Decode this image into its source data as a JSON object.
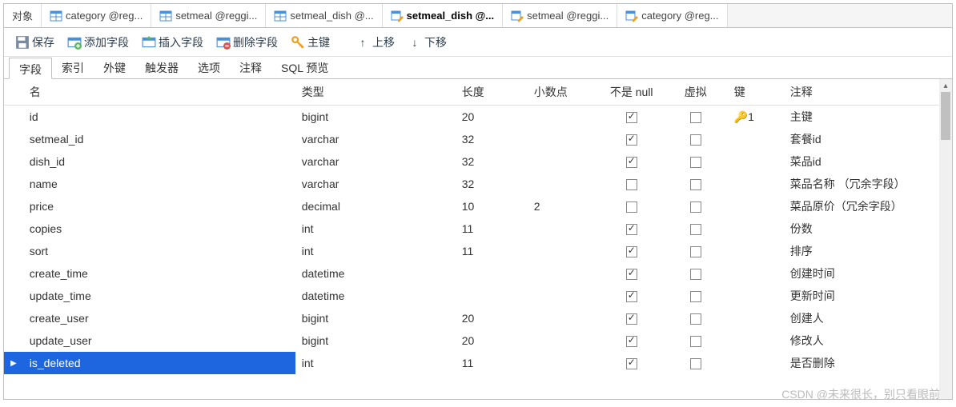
{
  "topTabs": [
    {
      "label": "对象",
      "icon": null,
      "active": false
    },
    {
      "label": "category @reg...",
      "icon": "table",
      "active": false
    },
    {
      "label": "setmeal @reggi...",
      "icon": "table",
      "active": false
    },
    {
      "label": "setmeal_dish @...",
      "icon": "table",
      "active": false
    },
    {
      "label": "setmeal_dish @...",
      "icon": "edit",
      "active": true
    },
    {
      "label": "setmeal @reggi...",
      "icon": "edit",
      "active": false
    },
    {
      "label": "category @reg...",
      "icon": "edit",
      "active": false
    }
  ],
  "toolbar": {
    "save": "保存",
    "addField": "添加字段",
    "insertField": "插入字段",
    "deleteField": "删除字段",
    "primaryKey": "主键",
    "moveUp": "上移",
    "moveDown": "下移"
  },
  "subTabs": [
    "字段",
    "索引",
    "外键",
    "触发器",
    "选项",
    "注释",
    "SQL 预览"
  ],
  "subActive": 0,
  "headers": {
    "name": "名",
    "type": "类型",
    "length": "长度",
    "decimal": "小数点",
    "notnull": "不是 null",
    "virtual": "虚拟",
    "key": "键",
    "comment": "注释"
  },
  "rows": [
    {
      "name": "id",
      "type": "bigint",
      "length": "20",
      "decimal": "",
      "notnull": true,
      "virtual": false,
      "key": "1",
      "comment": "主键"
    },
    {
      "name": "setmeal_id",
      "type": "varchar",
      "length": "32",
      "decimal": "",
      "notnull": true,
      "virtual": false,
      "key": "",
      "comment": "套餐id"
    },
    {
      "name": "dish_id",
      "type": "varchar",
      "length": "32",
      "decimal": "",
      "notnull": true,
      "virtual": false,
      "key": "",
      "comment": "菜品id"
    },
    {
      "name": "name",
      "type": "varchar",
      "length": "32",
      "decimal": "",
      "notnull": false,
      "virtual": false,
      "key": "",
      "comment": "菜品名称 （冗余字段）"
    },
    {
      "name": "price",
      "type": "decimal",
      "length": "10",
      "decimal": "2",
      "notnull": false,
      "virtual": false,
      "key": "",
      "comment": "菜品原价（冗余字段）"
    },
    {
      "name": "copies",
      "type": "int",
      "length": "11",
      "decimal": "",
      "notnull": true,
      "virtual": false,
      "key": "",
      "comment": "份数"
    },
    {
      "name": "sort",
      "type": "int",
      "length": "11",
      "decimal": "",
      "notnull": true,
      "virtual": false,
      "key": "",
      "comment": "排序"
    },
    {
      "name": "create_time",
      "type": "datetime",
      "length": "",
      "decimal": "",
      "notnull": true,
      "virtual": false,
      "key": "",
      "comment": "创建时间"
    },
    {
      "name": "update_time",
      "type": "datetime",
      "length": "",
      "decimal": "",
      "notnull": true,
      "virtual": false,
      "key": "",
      "comment": "更新时间"
    },
    {
      "name": "create_user",
      "type": "bigint",
      "length": "20",
      "decimal": "",
      "notnull": true,
      "virtual": false,
      "key": "",
      "comment": "创建人"
    },
    {
      "name": "update_user",
      "type": "bigint",
      "length": "20",
      "decimal": "",
      "notnull": true,
      "virtual": false,
      "key": "",
      "comment": "修改人"
    },
    {
      "name": "is_deleted",
      "type": "int",
      "length": "11",
      "decimal": "",
      "notnull": true,
      "virtual": false,
      "key": "",
      "comment": "是否删除"
    }
  ],
  "selectedRow": 11,
  "watermark": "CSDN @未来很长，别只看眼前"
}
